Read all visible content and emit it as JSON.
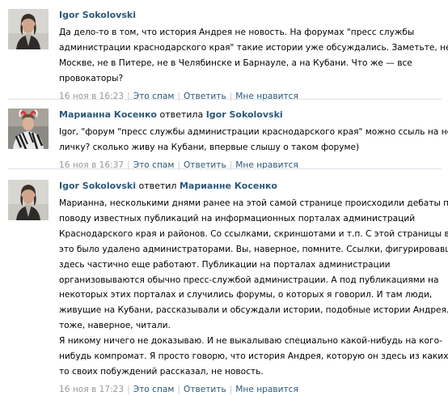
{
  "comments": [
    {
      "author": "Igor Sokolovski",
      "reply_text": "",
      "reply_to": "",
      "lines": [
        "Да дело-то в том, что история Андрея не новость. На форумах \"пресс службы",
        "администрации краснодарского края\" такие истории уже обсуждались. Заметьте, не в",
        "Москве, не в Питере, не в Челябинске и Барнауле, а на Кубани. Что же — все",
        "провокаторы?"
      ],
      "date": "16 ноя в 16:23",
      "spam_label": "Это спам",
      "reply_label": "Ответить",
      "like_label": "Мне нравится"
    },
    {
      "author": "Марианна Косенко",
      "reply_text": "ответила",
      "reply_to": "Igor Sokolovski",
      "lines": [
        "Igor, \"форум \"пресс службы администрации краснодарского края\" можно ссыль на него в",
        "личку? сколько живу на Кубани, впервые слышу о таком форуме)"
      ],
      "date": "16 ноя в 16:37",
      "spam_label": "Это спам",
      "reply_label": "Ответить",
      "like_label": "Мне нравится"
    },
    {
      "author": "Igor Sokolovski",
      "reply_text": "ответил",
      "reply_to": "Марианне Косенко",
      "lines": [
        "Марианна, несколькими днями ранее на этой самой странице происходили дебаты по",
        "поводу известных публикаций на информационных порталах администраций",
        "Краснодарского края и районов. Со ссылками, скриншотами и т.п. С этой страницы все",
        "это было удалено администраторами. Вы, наверное, помните. Ссылки, фигурировавшие",
        "здесь частично еще работают. Публикации на порталах администрации",
        "организовываются обычно пресс-службой администрации. А под публикациями на",
        "некоторых этих порталах и случились форумы, о которых я говорил. И там люди,",
        "живущие на Кубани, рассказывали и обсуждали истории, подобные истории Андрея. Вы",
        "тоже, наверное, читали.",
        "Я никому ничего не доказываю. И не выкалываю специально какой-нибудь на кого-",
        "нибудь компромат. Я просто говорю, что история Андрея, которую он здесь из каких-",
        "то своих побуждений рассказал, не новость."
      ],
      "date": "16 ноя в 17:23",
      "spam_label": "Это спам",
      "reply_label": "Ответить",
      "like_label": "Мне нравится"
    }
  ],
  "colors": {
    "link": "#2b587a",
    "meta": "#999999",
    "divider": "#dae1e8"
  },
  "icons": {
    "avatar1": "person-photo-avatar",
    "avatar2": "person-photo-avatar",
    "avatar3": "person-photo-avatar"
  }
}
